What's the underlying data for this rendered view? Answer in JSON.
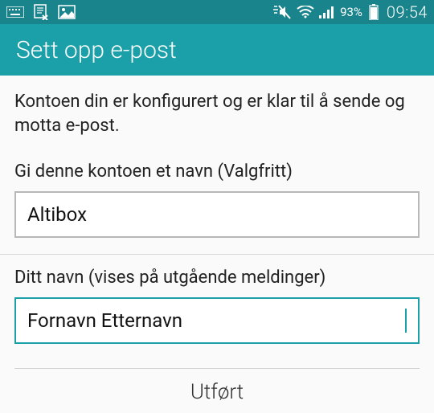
{
  "status": {
    "battery_pct": "93%",
    "time": "09:54"
  },
  "header": {
    "title": "Sett opp e-post"
  },
  "content": {
    "intro": "Kontoen din er konfigurert og er klar til å sende og motta e-post.",
    "account_name_label": "Gi denne kontoen et navn (Valgfritt)",
    "account_name_value": "Altibox",
    "your_name_label": "Ditt navn (vises på utgående meldinger)",
    "your_name_value": "Fornavn Etternavn"
  },
  "actions": {
    "done_label": "Utført"
  }
}
